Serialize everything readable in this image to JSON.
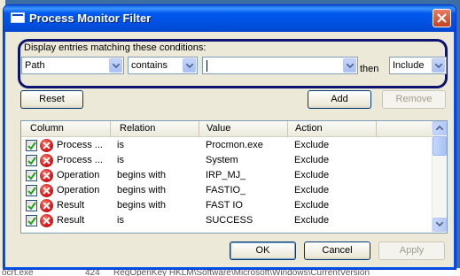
{
  "window": {
    "title": "Process Monitor Filter"
  },
  "conditions": {
    "label": "Display entries matching these conditions:",
    "column_value": "Path",
    "relation_value": "contains",
    "value_input": "",
    "then_label": "then",
    "action_value": "Include"
  },
  "buttons": {
    "reset": "Reset",
    "add": "Add",
    "remove": "Remove",
    "ok": "OK",
    "cancel": "Cancel",
    "apply": "Apply"
  },
  "list": {
    "headers": [
      "Column",
      "Relation",
      "Value",
      "Action"
    ],
    "rows": [
      {
        "column": "Process ...",
        "relation": "is",
        "value": "Procmon.exe",
        "action": "Exclude",
        "checked": true
      },
      {
        "column": "Process ...",
        "relation": "is",
        "value": "System",
        "action": "Exclude",
        "checked": true
      },
      {
        "column": "Operation",
        "relation": "begins with",
        "value": "IRP_MJ_",
        "action": "Exclude",
        "checked": true
      },
      {
        "column": "Operation",
        "relation": "begins with",
        "value": "FASTIO_",
        "action": "Exclude",
        "checked": true
      },
      {
        "column": "Result",
        "relation": "begins with",
        "value": "FAST IO",
        "action": "Exclude",
        "checked": true
      },
      {
        "column": "Result",
        "relation": "is",
        "value": "SUCCESS",
        "action": "Exclude",
        "checked": true
      }
    ]
  },
  "background_text": {
    "bottom_left": "ocrt.exe",
    "bottom_mid": "424",
    "bottom_right": "RegOpenKey   HKLM\\Software\\Microsoft\\Windows\\CurrentVersion"
  },
  "colors": {
    "title_bar": "#0058ee",
    "focus_outline": "#0d1470",
    "exclude_icon": "#d2161a"
  }
}
